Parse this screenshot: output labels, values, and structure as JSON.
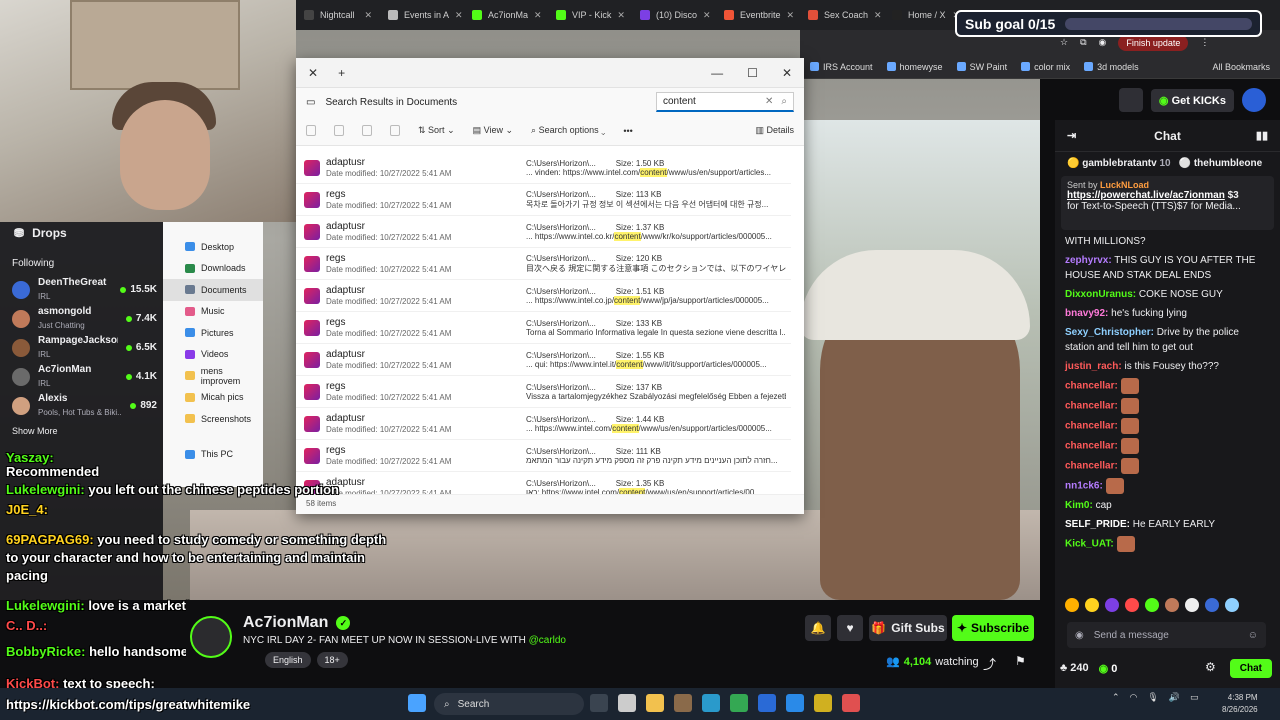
{
  "browser": {
    "tabs": [
      {
        "label": "Nightcall",
        "color": "#444444"
      },
      {
        "label": "Events in A",
        "color": "#bbbbbb"
      },
      {
        "label": "Ac7ionMa",
        "color": "#53fc18"
      },
      {
        "label": "VIP - Kick",
        "color": "#53fc18"
      },
      {
        "label": "(10) Disco",
        "color": "#7c3fe4"
      },
      {
        "label": "Eventbrite",
        "color": "#f05537"
      },
      {
        "label": "Sex Coach",
        "color": "#e0503a"
      },
      {
        "label": "Home / X",
        "color": "#222222"
      }
    ],
    "finish_update": "Finish update",
    "bookmarks": [
      "IRS Account",
      "homewyse",
      "SW Paint",
      "color mix",
      "3d models"
    ],
    "all_bookmarks": "All Bookmarks"
  },
  "sub_goal": {
    "label": "Sub goal 0/15",
    "progress": 0
  },
  "explorer": {
    "address": "Search Results in Documents",
    "search_value": "content",
    "commands": {
      "sort": "Sort",
      "view": "View",
      "search_options": "Search options",
      "details": "Details"
    },
    "status": "58 items",
    "nav": [
      {
        "label": "Desktop",
        "color": "#3b8ee8"
      },
      {
        "label": "Downloads",
        "color": "#2a8a4a"
      },
      {
        "label": "Documents",
        "color": "#6a7a90"
      },
      {
        "label": "Music",
        "color": "#e35b8a"
      },
      {
        "label": "Pictures",
        "color": "#3b8ee8"
      },
      {
        "label": "Videos",
        "color": "#8a3be8"
      },
      {
        "label": "mens improvem",
        "color": "#f2c14e"
      },
      {
        "label": "Micah pics",
        "color": "#f2c14e"
      },
      {
        "label": "Screenshots",
        "color": "#f2c14e"
      },
      {
        "label": "This PC",
        "color": "#3b8ee8"
      }
    ],
    "rows": [
      {
        "name": "adaptusr",
        "modified": "10/27/2022 5:41 AM",
        "path": "C:\\Users\\Horizon\\...",
        "size": "1.50 KB",
        "snippet": "... vinden: https://www.intel.com/content/www/us/en/support/articles..."
      },
      {
        "name": "regs",
        "modified": "10/27/2022 5:41 AM",
        "path": "C:\\Users\\Horizon\\...",
        "size": "113 KB",
        "snippet": "목차로 돌아가기 규정 정보 이 섹션에서는 다음 우선 어댑터에 대한 규정..."
      },
      {
        "name": "adaptusr",
        "modified": "10/27/2022 5:41 AM",
        "path": "C:\\Users\\Horizon\\...",
        "size": "1.37 KB",
        "snippet": "... https://www.intel.co.kr/content/www/kr/ko/support/articles/000005..."
      },
      {
        "name": "regs",
        "modified": "10/27/2022 5:41 AM",
        "path": "C:\\Users\\Horizon\\...",
        "size": "120 KB",
        "snippet": "目次へ戻る 規定に関する注意事項 このセクションでは、以下のワイヤレスアダプタ..."
      },
      {
        "name": "adaptusr",
        "modified": "10/27/2022 5:41 AM",
        "path": "C:\\Users\\Horizon\\...",
        "size": "1.51 KB",
        "snippet": "... https://www.intel.co.jp/content/www/jp/ja/support/articles/000005..."
      },
      {
        "name": "regs",
        "modified": "10/27/2022 5:41 AM",
        "path": "C:\\Users\\Horizon\\...",
        "size": "133 KB",
        "snippet": "Torna al Sommario Informativa legale In questa sezione viene descritta l..."
      },
      {
        "name": "adaptusr",
        "modified": "10/27/2022 5:41 AM",
        "path": "C:\\Users\\Horizon\\...",
        "size": "1.55 KB",
        "snippet": "... qui: https://www.intel.it/content/www/it/it/support/articles/000005..."
      },
      {
        "name": "regs",
        "modified": "10/27/2022 5:41 AM",
        "path": "C:\\Users\\Horizon\\...",
        "size": "137 KB",
        "snippet": "Vissza a tartalomjegyzékhez Szabályozási megfelelőség Ebben a fejezetb..."
      },
      {
        "name": "adaptusr",
        "modified": "10/27/2022 5:41 AM",
        "path": "C:\\Users\\Horizon\\...",
        "size": "1.44 KB",
        "snippet": "... https://www.intel.com/content/www/us/en/support/articles/000005..."
      },
      {
        "name": "regs",
        "modified": "10/27/2022 5:41 AM",
        "path": "C:\\Users\\Horizon\\...",
        "size": "111 KB",
        "snippet": "חזרה לתוכן העניינים מידע תקינה פרק זה מספק מידע תקינה עבור המתאמ..."
      },
      {
        "name": "adaptusr",
        "modified": "10/27/2022 5:41 AM",
        "path": "C:\\Users\\Horizon\\...",
        "size": "1.35 KB",
        "snippet": "כאן: https://www.intel.com/content/www/us/en/support/articles/00..."
      }
    ]
  },
  "sidebar": {
    "drops": "Drops",
    "following": "Following",
    "channels": [
      {
        "name": "DeenTheGreat",
        "sub": "IRL",
        "viewers": "15.5K",
        "color": "#3a6ad6"
      },
      {
        "name": "asmongold",
        "sub": "Just Chatting",
        "viewers": "7.4K",
        "color": "#c07a5a"
      },
      {
        "name": "RampageJackson",
        "sub": "IRL",
        "viewers": "6.5K",
        "color": "#8a5a3a"
      },
      {
        "name": "Ac7ionMan",
        "sub": "IRL",
        "viewers": "4.1K",
        "color": "#6a6a6a"
      },
      {
        "name": "Alexis",
        "sub": "Pools, Hot Tubs & Biki...",
        "viewers": "892",
        "color": "#d0a080"
      }
    ],
    "show_more": "Show More"
  },
  "overlay": [
    {
      "user": "Yaszay:",
      "text": "",
      "color": "u"
    },
    {
      "user": "Recommended",
      "text": "",
      "color": ""
    },
    {
      "user": "Lukelewgini:",
      "text": " you left out the chinese peptides portion",
      "color": "u"
    },
    {
      "user": "J0E_4:",
      "text": "",
      "color": "u2"
    },
    {
      "user": "69PAGPAG69:",
      "text": " you need to study comedy or something depth",
      "color": "u2"
    },
    {
      "user": "",
      "text": "to your character and how to be entertaining and maintain",
      "color": ""
    },
    {
      "user": "",
      "text": "pacing",
      "color": ""
    },
    {
      "user": "Lukelewgini:",
      "text": " love is a marketing scam",
      "color": "u"
    },
    {
      "user": "C.. D..:",
      "text": "",
      "color": "u3"
    },
    {
      "user": "BobbyRicke:",
      "text": " hello handsome how are you",
      "color": "u"
    },
    {
      "user": "KickBot:",
      "text": " text to speech:",
      "color": "u3"
    }
  ],
  "footer_url": "https://kickbot.com/tips/greatwhitemike",
  "stream": {
    "name": "Ac7ionMan",
    "title": "NYC IRL DAY 2- FAN MEET UP NOW IN SESSION-LIVE WITH",
    "title_mention": "@carldo",
    "tags": [
      "English",
      "18+"
    ],
    "gift_subs": "Gift Subs",
    "subscribe": "Subscribe",
    "watching_count": "4,104",
    "watching_label": "watching"
  },
  "kick_header": {
    "get_kicks": "Get KICKs"
  },
  "chat": {
    "title": "Chat",
    "top_gifters": [
      {
        "name": "gamblebratantv",
        "count": "10"
      },
      {
        "name": "thehumbleone",
        "count": ""
      }
    ],
    "pinned": {
      "sent_by": "Sent by",
      "sender": "LuckNLoad",
      "link": "https://powerchat.live/ac7ionman",
      "amount": "$3",
      "text": "for Text-to-Speech (TTS)$7 for Media..."
    },
    "messages": [
      {
        "user": "",
        "text": "WITH MILLIONS?",
        "color": "#ffffff"
      },
      {
        "user": "zephyrvx:",
        "text": "THIS GUY IS YOU AFTER THE HOUSE AND STAK DEAL ENDS",
        "color": "#b57cff"
      },
      {
        "user": "DixxonUranus:",
        "text": "COKE NOSE GUY",
        "color": "#53fc18"
      },
      {
        "user": "bnavy92:",
        "text": "he's fucking lying",
        "color": "#ff7ad9"
      },
      {
        "user": "Sexy_Christopher:",
        "text": "Drive by the police station and tell him to get out",
        "color": "#8fd0ff"
      },
      {
        "user": "justin_rach:",
        "text": "is this Fousey tho???",
        "color": "#ff5a5a"
      },
      {
        "user": "chancellar:",
        "text": "",
        "color": "#ff5a5a"
      },
      {
        "user": "chancellar:",
        "text": "",
        "color": "#ff5a5a"
      },
      {
        "user": "chancellar:",
        "text": "",
        "color": "#ff5a5a"
      },
      {
        "user": "chancellar:",
        "text": "",
        "color": "#ff5a5a"
      },
      {
        "user": "chancellar:",
        "text": "",
        "color": "#ff5a5a"
      },
      {
        "user": "nn1ck6:",
        "text": "",
        "color": "#b57cff"
      },
      {
        "user": "Kim0:",
        "text": "cap",
        "color": "#53fc18"
      },
      {
        "user": "SELF_PRIDE:",
        "text": "He EARLY EARLY",
        "color": "#ffffff"
      },
      {
        "user": "Kick_UAT:",
        "text": "",
        "color": "#53fc18"
      }
    ],
    "send_placeholder": "Send a message",
    "kicks_count": "240",
    "points": "0",
    "chat_button": "Chat"
  },
  "taskbar": {
    "search": "Search",
    "time": "4:38 PM",
    "date": "8/26/2026"
  }
}
